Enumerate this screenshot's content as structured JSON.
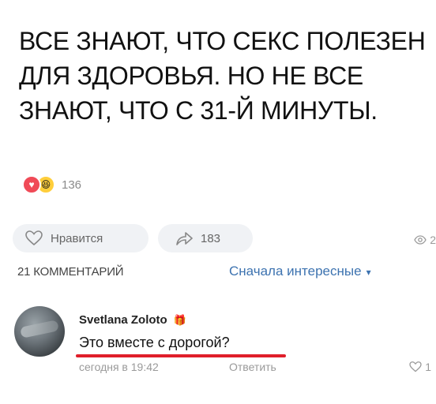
{
  "post": {
    "text": "ВСЕ ЗНАЮТ, ЧТО СЕКС ПОЛЕЗЕН ДЛЯ ЗДОРОВЬЯ. НО НЕ ВСЕ ЗНАЮТ, ЧТО С 31-Й МИНУТЫ.",
    "reaction_count": "136",
    "reactions": [
      "heart-icon",
      "laugh-emoji-icon"
    ]
  },
  "actions": {
    "like_label": "Нравится",
    "share_count": "183",
    "views_count": "2"
  },
  "comments": {
    "count_label": "21 КОММЕНТАРИЙ",
    "sort_label": "Сначала интересные",
    "items": [
      {
        "author": "Svetlana Zoloto",
        "text": "Это вместе с дорогой?",
        "time": "сегодня в 19:42",
        "reply_label": "Ответить",
        "likes": "1"
      }
    ]
  },
  "colors": {
    "accent": "#3d73b0",
    "underline": "#e01e2a",
    "heart": "#f04a57"
  }
}
